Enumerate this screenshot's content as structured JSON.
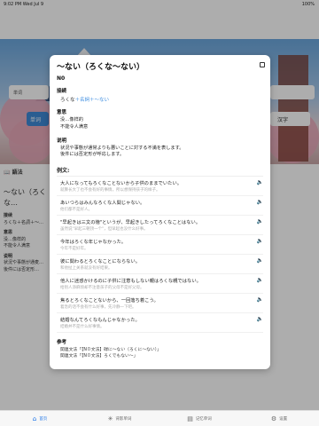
{
  "status": {
    "time": "9:02 PM  Wed Jul 9",
    "battery": "100%"
  },
  "background": {
    "search_placeholder": "単词",
    "search_button": "单词",
    "right_button": "汉字",
    "section_title": "語法",
    "grammar_title": "～ない（ろくな…",
    "conn_label": "接续",
    "conn_value": "ろくな＋名詞＋～…",
    "meaning_label": "意思",
    "meaning_1": "没…像样的",
    "meaning_2": "不能令人满意",
    "explain_label": "说明",
    "explain_1": "状況や事態が通麦…",
    "explain_2": "後件には否定形…"
  },
  "modal": {
    "title": "～ない（ろくな～ない）",
    "level": "N0",
    "connection_label": "接続",
    "connection_prefix": "ろくな",
    "connection_value": "＋名詞＋～ない",
    "meaning_label": "意思",
    "meaning_lines": [
      "没…像样的",
      "不能令人满意"
    ],
    "explanation_label": "说明",
    "explanation_lines": [
      "状況や事態が通常よりも悪いことに対する不満を表します。",
      "後件には否定形が呼応します。"
    ],
    "examples_label": "例文:",
    "examples": [
      {
        "jp": "大人になってもろくなことないから子供のままでいたい。",
        "cn": "就算长大了也不会有好的事情，所以想保持孩子的样子。"
      },
      {
        "jp": "あいつらはみんなろくな人間じゃない。",
        "cn": "他们都不是好人。"
      },
      {
        "jp": "\"早起きは三文の徳\"というが、早起きしたってろくなことはない。",
        "cn": "虽然说\"早起三朝顶一个\"，但早起也没什么好事。"
      },
      {
        "jp": "今年はろくな年じゃなかった。",
        "cn": "今年不是好年。"
      },
      {
        "jp": "彼に関わるとろくなことにならない。",
        "cn": "和他扯上关系就没有好结果。"
      },
      {
        "jp": "他人に迷惑かけるのに子供に注意もしない親はろくな親ではない。",
        "cn": "给别人添麻烦却不注意孩子的父母不是好父母。"
      },
      {
        "jp": "焦るとろくなことないから、一回落ち着こう。",
        "cn": "着急的话不会有什么好事，先冷静一下吧。"
      },
      {
        "jp": "結婚なんてろくなもんじゃなかった。",
        "cn": "结婚并不是什么好事情。"
      }
    ],
    "reference_label": "参考",
    "references": [
      "関連文法「【N０文法】碌に～ない（ろくに～ない）」",
      "関連文法「【N０文法】ろくでもない～」"
    ]
  },
  "tabs": [
    {
      "label": "首页",
      "icon": "home-icon"
    },
    {
      "label": "背影单词",
      "icon": "asterisk-icon"
    },
    {
      "label": "记忆单词",
      "icon": "book-icon"
    },
    {
      "label": "设置",
      "icon": "gear-icon"
    }
  ]
}
